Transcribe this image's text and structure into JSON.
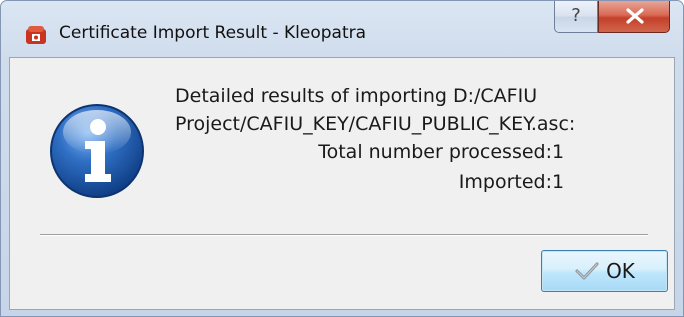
{
  "window": {
    "title": "Certificate Import Result - Kleopatra",
    "help_glyph": "?",
    "close_icon": "close-icon",
    "app_icon": "kleopatra-app-icon"
  },
  "dialog": {
    "icon": "information-icon",
    "message_line1": "Detailed results of importing D:/CAFIU",
    "message_line2": "Project/CAFIU_KEY/CAFIU_PUBLIC_KEY.asc:",
    "results": [
      {
        "label": "Total number processed:",
        "value": "1"
      },
      {
        "label": "Imported:",
        "value": "1"
      }
    ],
    "ok_label": "OK",
    "ok_icon": "checkmark-icon"
  },
  "colors": {
    "titlebar": "#cfdcec",
    "client_bg": "#f0f0f0",
    "close_red": "#c4402a",
    "info_blue": "#1e5aa8",
    "ok_button": "#bee6fd"
  }
}
